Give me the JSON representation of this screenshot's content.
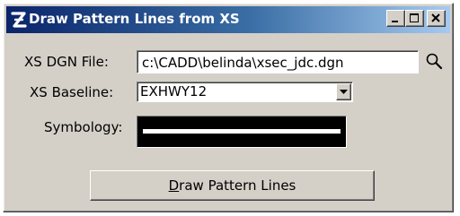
{
  "window": {
    "title": "Draw Pattern Lines from XS",
    "title_bar_color": "#0a246a",
    "background_color": "#d4d0c8"
  },
  "title_buttons": {
    "minimize_icon": "minimize-icon",
    "maximize_icon": "maximize-icon",
    "close_icon": "close-icon"
  },
  "form": {
    "xs_dgn_file_label": "XS DGN File:",
    "xs_dgn_file_value": "c:\\CADD\\belinda\\xsec_jdc.dgn",
    "browse_icon": "search-icon",
    "xs_baseline_label": "XS Baseline:",
    "xs_baseline_value": "EXHWY12",
    "symbology_label": "Symbology:",
    "symbology_preview": {
      "background": "#000000",
      "line_color": "#ffffff"
    }
  },
  "actions": {
    "draw_button_first_letter": "D",
    "draw_button_rest": "raw Pattern Lines"
  }
}
